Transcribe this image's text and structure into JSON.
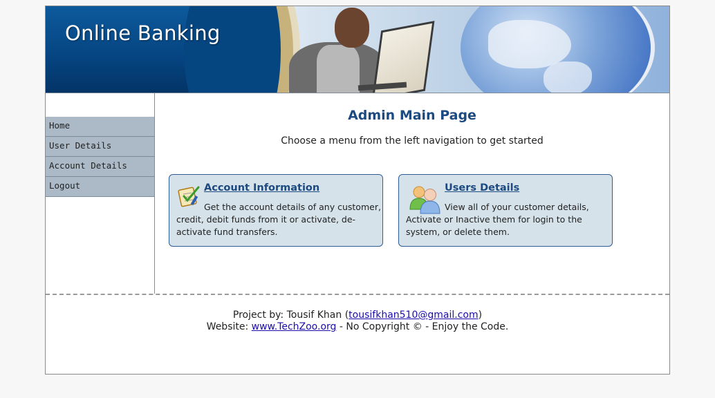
{
  "banner": {
    "logo_text": "Online Banking"
  },
  "sidebar": {
    "items": [
      {
        "label": "Home"
      },
      {
        "label": "User Details"
      },
      {
        "label": "Account Details"
      },
      {
        "label": "Logout"
      }
    ]
  },
  "main": {
    "title": "Admin Main Page",
    "subtitle": "Choose a menu from the left navigation to get started",
    "cards": [
      {
        "title": "Account Information",
        "text": "Get the account details of any customer, credit, debit funds from it or activate, de-activate fund transfers.",
        "icon": "checklist-icon"
      },
      {
        "title": "Users Details",
        "text": "View all of your customer details, Activate or Inactive them for login to the system, or delete them.",
        "icon": "users-icon"
      }
    ]
  },
  "footer": {
    "project_prefix": "Project by: Tousif Khan (",
    "email": "tousifkhan510@gmail.com",
    "project_suffix": ")",
    "website_prefix": "Website: ",
    "website": "www.TechZoo.org",
    "website_suffix": " - No Copyright © - Enjoy the Code."
  },
  "colors": {
    "accent": "#1d4a80",
    "menu_bg": "#acbac8",
    "card_bg": "#d5e2ea",
    "link": "#1a0dab"
  }
}
